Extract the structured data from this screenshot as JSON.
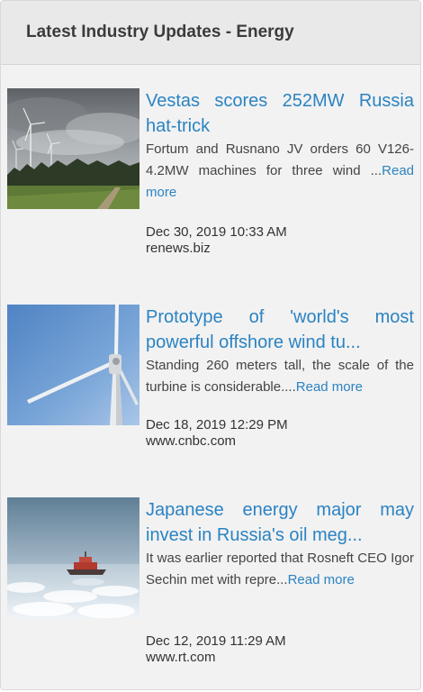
{
  "panel": {
    "title": "Latest Industry Updates - Energy"
  },
  "articles": [
    {
      "headline": "Vestas scores 252MW Russia hat-trick",
      "summary": "Fortum and Rusnano JV orders 60 V126-4.2MW machines for three wind ...",
      "read_more": "Read more",
      "date": "Dec 30, 2019 10:33 AM",
      "source": "renews.biz",
      "thumbnail_icon": "wind-farm-image"
    },
    {
      "headline": "Prototype of 'world's most powerful offshore wind tu...",
      "summary": "Standing 260 meters tall, the scale of the turbine is considerable....",
      "read_more": "Read more",
      "date": "Dec 18, 2019 12:29 PM",
      "source": "www.cnbc.com",
      "thumbnail_icon": "wind-turbine-image"
    },
    {
      "headline": "Japanese energy major may invest in Russia's oil meg...",
      "summary": "It was earlier reported that Rosneft CEO Igor Sechin met with repre...",
      "read_more": "Read more",
      "date": "Dec 12, 2019 11:29 AM",
      "source": "www.rt.com",
      "thumbnail_icon": "icebreaker-ship-image"
    }
  ],
  "colors": {
    "link": "#2b83c2",
    "header_bg": "#e9e9e9",
    "panel_bg": "#f2f2f2"
  }
}
